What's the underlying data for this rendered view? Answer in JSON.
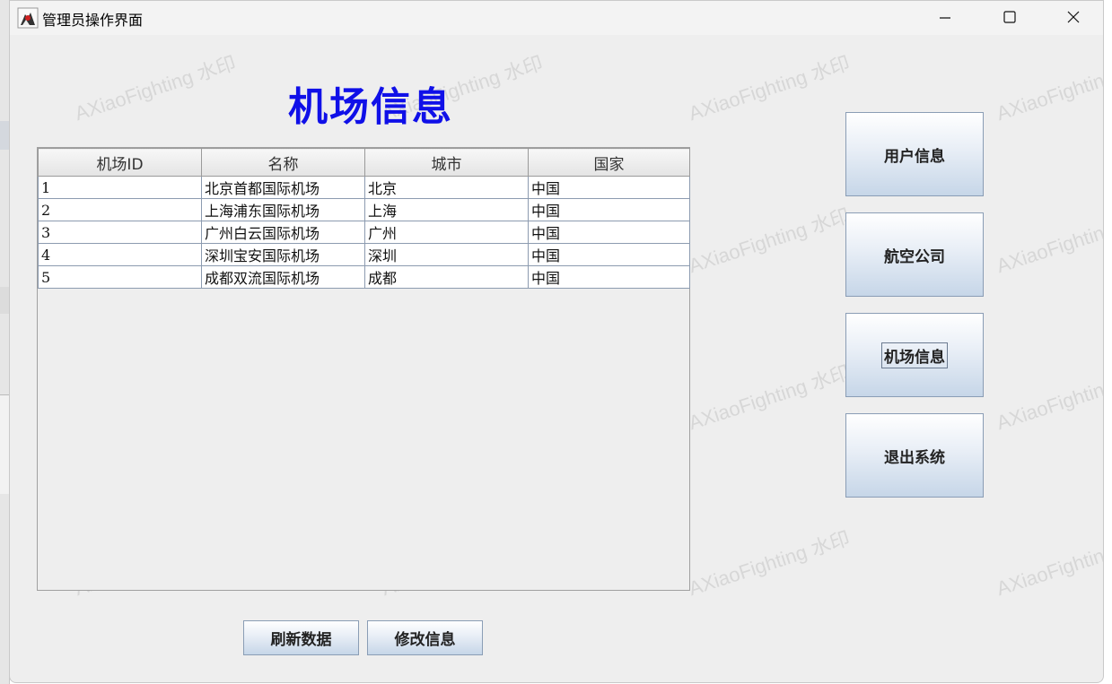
{
  "window": {
    "title": "管理员操作界面"
  },
  "watermark": "AXiaoFighting 水印",
  "heading": "机场信息",
  "table": {
    "columns": [
      "机场ID",
      "名称",
      "城市",
      "国家"
    ],
    "rows": [
      [
        "1",
        "北京首都国际机场",
        "北京",
        "中国"
      ],
      [
        "2",
        "上海浦东国际机场",
        "上海",
        "中国"
      ],
      [
        "3",
        "广州白云国际机场",
        "广州",
        "中国"
      ],
      [
        "4",
        "深圳宝安国际机场",
        "深圳",
        "中国"
      ],
      [
        "5",
        "成都双流国际机场",
        "成都",
        "中国"
      ]
    ]
  },
  "side_menu": [
    "用户信息",
    "航空公司",
    "机场信息",
    "退出系统"
  ],
  "bottom_buttons": {
    "refresh": "刷新数据",
    "edit": "修改信息"
  },
  "colors": {
    "heading": "#1010e8",
    "window_bg": "#eeeeee",
    "button_gradient_bottom": "#c6d6e8"
  },
  "icons": {
    "app": "java-duke-icon",
    "minimize": "minimize-icon",
    "maximize": "maximize-icon",
    "close": "close-icon"
  }
}
